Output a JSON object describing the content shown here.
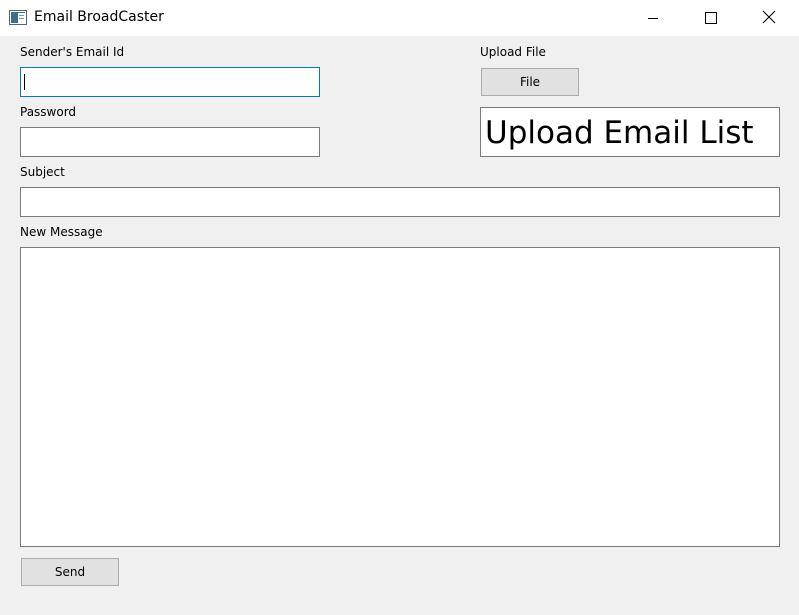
{
  "window": {
    "title": "Email BroadCaster",
    "icons": {
      "app": "window-app-icon",
      "minimize": "minimize-icon",
      "maximize": "maximize-icon",
      "close": "close-icon"
    }
  },
  "form": {
    "sender_email_label": "Sender's Email Id",
    "sender_email_value": "",
    "password_label": "Password",
    "password_value": "",
    "subject_label": "Subject",
    "subject_value": "",
    "message_label": "New Message",
    "message_value": ""
  },
  "upload": {
    "label": "Upload File",
    "file_button_label": "File",
    "status_text": "Upload Email List"
  },
  "actions": {
    "send_label": "Send"
  }
}
